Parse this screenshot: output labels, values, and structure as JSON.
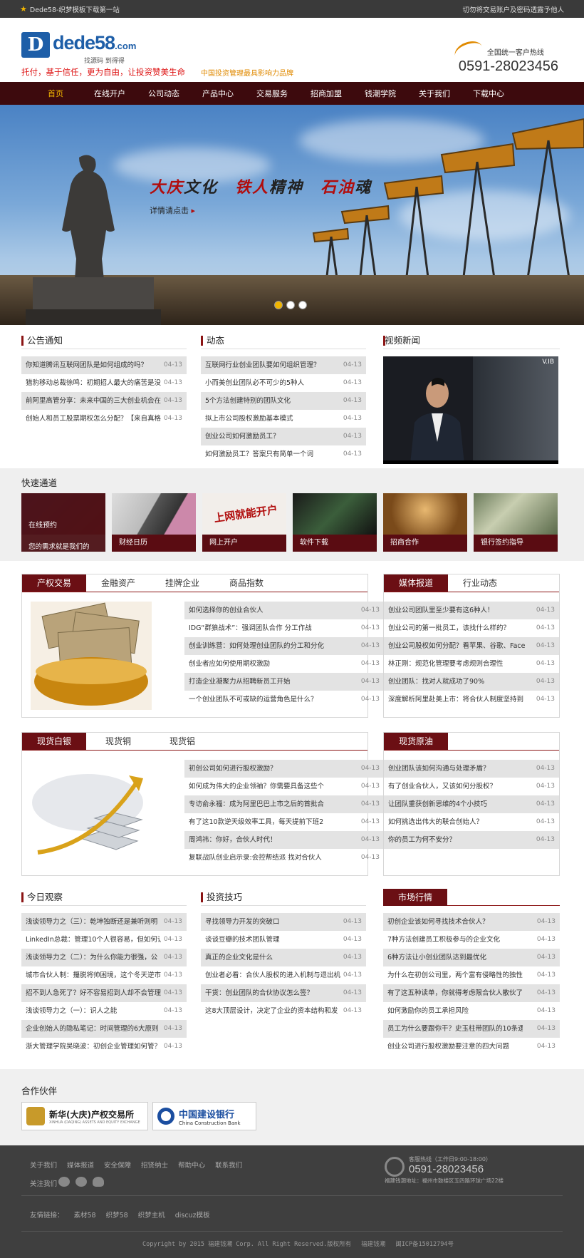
{
  "topbar": {
    "site": "Dede58-织梦模板下载第一站",
    "notice": "切勿将交易账户及密码透露予他人"
  },
  "logo": {
    "mark": "D",
    "name": "dede58",
    "tld": ".com",
    "sub": "找源码  到得得"
  },
  "slogan": {
    "main": "托付，基于信任，更为自由，让投资赞美生命",
    "brand": "中国投资管理最具影响力品牌"
  },
  "hotline": {
    "label": "全国统一客户热线",
    "number": "0591-28023456"
  },
  "nav": [
    "首页",
    "在线开户",
    "公司动态",
    "产品中心",
    "交易服务",
    "招商加盟",
    "钱潮学院",
    "关于我们",
    "下载中心"
  ],
  "banner": {
    "title": [
      "大庆",
      "文化",
      "铁人",
      "精神",
      "石油",
      "魂"
    ],
    "more": "详情请点击",
    "arrow": "▸"
  },
  "notice": {
    "title": "公告通知",
    "items": [
      {
        "t": "你知道腾讯互联网团队是如何组成的吗？",
        "d": "04-13"
      },
      {
        "t": "猎豹移动总裁徐鸣：初期招人最大的痛苦是没",
        "d": "04-13"
      },
      {
        "t": "前阿里高管分享：未来中国的三大创业机会在",
        "d": "04-13"
      },
      {
        "t": "创始人和员工股票期权怎么分配？【来自真格",
        "d": "04-13"
      }
    ]
  },
  "news": {
    "title": "动态",
    "items": [
      {
        "t": "互联网行业创业团队要如何组织管理？",
        "d": "04-13"
      },
      {
        "t": "小而美创业团队必不可少的5种人",
        "d": "04-13"
      },
      {
        "t": "5个方法创建特别的团队文化",
        "d": "04-13"
      },
      {
        "t": "拟上市公司股权激励基本模式",
        "d": "04-13"
      },
      {
        "t": "创业公司如何激励员工？",
        "d": "04-13"
      },
      {
        "t": "如何激励员工？答案只有简单一个词",
        "d": "04-13"
      }
    ]
  },
  "video": {
    "title": "视频新闻",
    "label": "V.IB"
  },
  "quick": {
    "title": "快速通道",
    "tiles": [
      {
        "cap": "在线预约",
        "sub": "您的需求就是我们的"
      },
      {
        "cap": "财经日历"
      },
      {
        "cap": "网上开户"
      },
      {
        "cap": "软件下载"
      },
      {
        "cap": "招商合作"
      },
      {
        "cap": "银行签约指导"
      }
    ],
    "tile3_text": "上网就能开户"
  },
  "box1": {
    "tabs": [
      "产权交易",
      "金融资产",
      "挂牌企业",
      "商品指数"
    ],
    "items": [
      {
        "t": "如何选择你的创业合伙人",
        "d": "04-13"
      },
      {
        "t": "IDG“群狼战术”：强调团队合作 分工作战",
        "d": "04-13"
      },
      {
        "t": "创业训练营：如何处理创业团队的分工和分化",
        "d": "04-13"
      },
      {
        "t": "创业者应如何使用期权激励",
        "d": "04-13"
      },
      {
        "t": "打造企业凝聚力从招聘新员工开始",
        "d": "04-13"
      },
      {
        "t": "一个创业团队不可或缺的运营角色是什么？",
        "d": "04-13"
      }
    ]
  },
  "box2": {
    "tabs": [
      "媒体报道",
      "行业动态"
    ],
    "items": [
      {
        "t": "创业公司团队里至少要有这6种人！",
        "d": "04-13"
      },
      {
        "t": "创业公司的第一批员工，该找什么样的？",
        "d": "04-13"
      },
      {
        "t": "创业公司股权如何分配？看苹果、谷歌、Face",
        "d": "04-13"
      },
      {
        "t": "林正刚：规范化管理要考虑规则合理性",
        "d": "04-13"
      },
      {
        "t": "创业团队：找对人就成功了90%",
        "d": "04-13"
      },
      {
        "t": "深度解析阿里赴美上市：将合伙人制度坚持到",
        "d": "04-13"
      }
    ]
  },
  "box3": {
    "tabs": [
      "现货白银",
      "现货铜",
      "现货铝"
    ],
    "items": [
      {
        "t": "初创公司如何进行股权激励？",
        "d": "04-13"
      },
      {
        "t": "如何成为伟大的企业领袖？你需要具备这些个",
        "d": "04-13"
      },
      {
        "t": "专访俞永福：成为阿里巴巴上市之后的首批合",
        "d": "04-13"
      },
      {
        "t": "有了这10款逆天级效率工具，每天提前下班2",
        "d": "04-13"
      },
      {
        "t": "周鸿祎：你好，合伙人时代！",
        "d": "04-13"
      },
      {
        "t": "复联战队创业启示录:会控帮结派 找对合伙人",
        "d": "04-13"
      }
    ]
  },
  "box4": {
    "tabs": [
      "现货原油"
    ],
    "items": [
      {
        "t": "创业团队该如何沟通与处理矛盾？",
        "d": "04-13"
      },
      {
        "t": "有了创业合伙人，又该如何分股权？",
        "d": "04-13"
      },
      {
        "t": "让团队重获创新思维的4个小技巧",
        "d": "04-13"
      },
      {
        "t": "如何挑选出伟大的联合创始人？",
        "d": "04-13"
      },
      {
        "t": "你的员工为何不安分？",
        "d": "04-13"
      }
    ]
  },
  "today": {
    "title": "今日观察",
    "items": [
      {
        "t": "浅谈领导力之（三）：乾坤独断还是兼听则明",
        "d": "04-13"
      },
      {
        "t": "LinkedIn总裁：管理10个人很容易，但如何让",
        "d": "04-13"
      },
      {
        "t": "浅谈领导力之（二）：为什么你能力很强，公",
        "d": "04-13"
      },
      {
        "t": "城市合伙人制：攥脱将帅困境，这个冬天逆市",
        "d": "04-13"
      },
      {
        "t": "招不到人急死了？好不容易招到人却不会管理",
        "d": "04-13"
      },
      {
        "t": "浅谈领导力之（一）：识人之能",
        "d": "04-13"
      },
      {
        "t": "企业创始人的隐私笔记：时间管理的6大原则",
        "d": "04-13"
      },
      {
        "t": "浙大管理学院吴晓波：初创企业管理如何管？",
        "d": "04-13"
      }
    ]
  },
  "tips": {
    "title": "投资技巧",
    "items": [
      {
        "t": "寻找领导力开发的突破口",
        "d": "04-13"
      },
      {
        "t": "谈谈豆瓣的技术团队管理",
        "d": "04-13"
      },
      {
        "t": "真正的企业文化是什么",
        "d": "04-13"
      },
      {
        "t": "创业者必看：合伙人股权的进入机制与退出机",
        "d": "04-13"
      },
      {
        "t": "干货：创业团队的合伙协议怎么签？",
        "d": "04-13"
      },
      {
        "t": "这8大顶层设计，决定了企业的资本结构和发",
        "d": "04-13"
      }
    ]
  },
  "market": {
    "title": "市场行情",
    "items": [
      {
        "t": "初创企业该如何寻找技术合伙人？",
        "d": "04-13"
      },
      {
        "t": "7种方法创建员工积极参与的企业文化",
        "d": "04-13"
      },
      {
        "t": "6种方法让小创业团队达到最优化",
        "d": "04-13"
      },
      {
        "t": "为什么在初创公司里，两个富有侵略性的独性",
        "d": "04-13"
      },
      {
        "t": "有了这五种读单，你就得考虑限合伙人散伙了",
        "d": "04-13"
      },
      {
        "t": "如何激励你的员工承担风险",
        "d": "04-13"
      },
      {
        "t": "员工为什么要跟你干？史玉柱带团队的10条逻",
        "d": "04-13"
      },
      {
        "t": "创业公司进行股权激励要注意的四大问题",
        "d": "04-13"
      }
    ]
  },
  "partners": {
    "title": "合作伙伴",
    "p1": "新华(大庆)产权交易所",
    "p1sub": "XINHUA (DAQING) ASSETS AND EQUITY EXCHANGE",
    "p2": "中国建设银行",
    "p2sub": "China Construction Bank"
  },
  "footer": {
    "links": [
      "关于我们",
      "媒体报道",
      "安全保障",
      "招贤纳士",
      "帮助中心",
      "联系我们"
    ],
    "follow": "关注我们",
    "service": "客服热线（工作日9:00-18:00）",
    "number": "0591-28023456",
    "address": "福建钱潮地址：福州市鼓楼区五四路环球广场22楼",
    "friends_label": "友情链接：",
    "friends": [
      "素材58",
      "织梦58",
      "织梦主机",
      "discuz模板"
    ],
    "copyright": "Copyright by 2015 福建钱潮 Corp. All Right Reserved.版权所有",
    "company": "福建钱潮",
    "icp": "闽ICP备15012794号"
  },
  "colors": {
    "brand": "#3d0a0d",
    "accent": "#f0b400",
    "red": "#b10d0d"
  }
}
